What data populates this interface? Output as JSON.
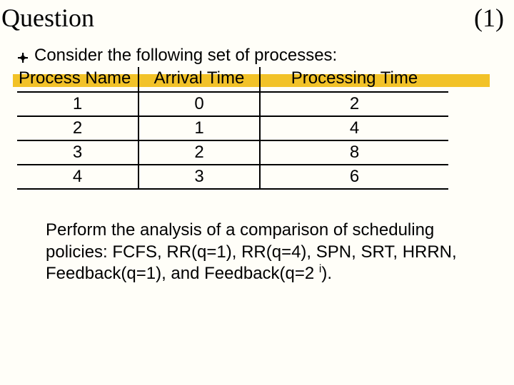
{
  "title": "Question",
  "title_number": "(1)",
  "bullet_text": "Consider the following set of processes:",
  "chart_data": {
    "type": "table",
    "headers": [
      "Process Name",
      "Arrival Time",
      "Processing Time"
    ],
    "rows": [
      {
        "name": "1",
        "arrival": "0",
        "processing": "2"
      },
      {
        "name": "2",
        "arrival": "1",
        "processing": "4"
      },
      {
        "name": "3",
        "arrival": "2",
        "processing": "8"
      },
      {
        "name": "4",
        "arrival": "3",
        "processing": "6"
      }
    ]
  },
  "instruction_pre": "Perform the analysis of a comparison of scheduling policies: FCFS, RR(q=1), RR(q=4), SPN, SRT, HRRN, Feedback(q=1), and   Feedback(q=2 ",
  "instruction_sup": "i",
  "instruction_post": ")."
}
